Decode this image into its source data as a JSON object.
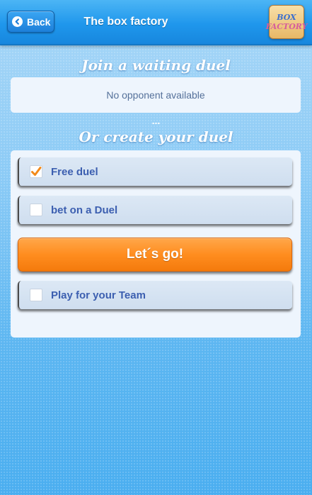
{
  "header": {
    "back_label": "Back",
    "title": "The box factory",
    "logo_line1": "BOX",
    "logo_line2": "FACTORY"
  },
  "join_section": {
    "title": "Join a waiting duel",
    "empty_message": "No opponent available"
  },
  "separator": "...",
  "create_section": {
    "title": "Or create your duel",
    "options": [
      {
        "label": "Free duel",
        "checked": true
      },
      {
        "label": "bet on a Duel",
        "checked": false
      },
      {
        "label": "Play for your Team",
        "checked": false
      }
    ],
    "go_label": "Let´s go!"
  },
  "colors": {
    "header_blue": "#1f97ec",
    "accent_orange": "#ff8d1f",
    "check_orange": "#f28a1a",
    "option_text": "#3c5fb0"
  }
}
